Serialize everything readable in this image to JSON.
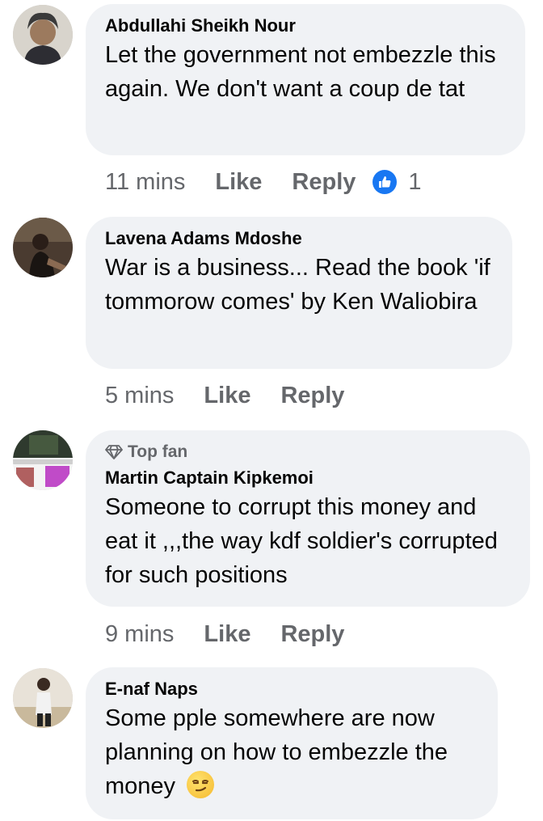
{
  "comments": [
    {
      "author": "Abdullahi Sheikh Nour",
      "text": "Let the government not embezzle this again. We don't want a coup de tat",
      "time": "11 mins",
      "like_label": "Like",
      "reply_label": "Reply",
      "reaction_count": "1",
      "avatar_icon": "profile-photo-icon"
    },
    {
      "author": "Lavena Adams Mdoshe",
      "text": "War is a business... Read the book 'if tommorow comes' by Ken Waliobira",
      "time": "5 mins",
      "like_label": "Like",
      "reply_label": "Reply",
      "avatar_icon": "profile-photo-icon"
    },
    {
      "badge": "Top fan",
      "badge_icon": "diamond-icon",
      "author": "Martin Captain Kipkemoi",
      "text": "Someone to corrupt this money and eat it ,,,the way kdf soldier's corrupted for such positions",
      "time": "9 mins",
      "like_label": "Like",
      "reply_label": "Reply",
      "avatar_icon": "profile-photo-icon"
    },
    {
      "author": "E-naf Naps",
      "text": "Some pple somewhere are now planning on how to embezzle the money",
      "emoji": "smirk-emoji",
      "avatar_icon": "profile-photo-icon"
    }
  ],
  "colors": {
    "bubble": "#f0f2f5",
    "meta_text": "#65676b",
    "like_blue": "#1877f2"
  }
}
